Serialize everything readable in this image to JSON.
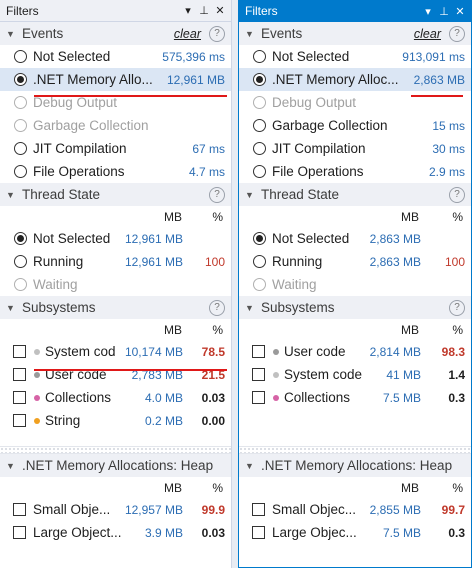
{
  "left": {
    "title": "Filters",
    "events": {
      "header": "Events",
      "clear": "clear",
      "help": "?",
      "items": [
        {
          "label": "Not Selected",
          "value": "575,396 ms",
          "state": "normal",
          "checked": false
        },
        {
          "label": ".NET Memory Allo...",
          "value": "12,961 MB",
          "state": "normal",
          "checked": true
        },
        {
          "label": "Debug Output",
          "value": "",
          "state": "disabled",
          "checked": false
        },
        {
          "label": "Garbage Collection",
          "value": "",
          "state": "disabled",
          "checked": false
        },
        {
          "label": "JIT Compilation",
          "value": "67 ms",
          "state": "normal",
          "checked": false
        },
        {
          "label": "File Operations",
          "value": "4.7 ms",
          "state": "normal",
          "checked": false
        }
      ]
    },
    "thread": {
      "header": "Thread State",
      "help": "?",
      "col_mb": "MB",
      "col_pct": "%",
      "items": [
        {
          "label": "Not Selected",
          "mb": "12,961 MB",
          "pct": "",
          "checked": true,
          "disabled": false
        },
        {
          "label": "Running",
          "mb": "12,961 MB",
          "pct": "100",
          "checked": false,
          "disabled": false
        },
        {
          "label": "Waiting",
          "mb": "",
          "pct": "",
          "checked": false,
          "disabled": true
        }
      ]
    },
    "subsystems": {
      "header": "Subsystems",
      "help": "?",
      "col_mb": "MB",
      "col_pct": "%",
      "items": [
        {
          "label": "System cod",
          "mb": "10,174 MB",
          "pct": "78.5",
          "dot": "#c0c0c0",
          "pct_color": "red"
        },
        {
          "label": "User code",
          "mb": "2,783 MB",
          "pct": "21.5",
          "dot": "#9a9a9a",
          "pct_color": "red"
        },
        {
          "label": "Collections",
          "mb": "4.0 MB",
          "pct": "0.03",
          "dot": "#d663a6",
          "pct_color": "black"
        },
        {
          "label": "String",
          "mb": "0.2 MB",
          "pct": "0.00",
          "dot": "#f0a020",
          "pct_color": "black"
        }
      ]
    },
    "heap": {
      "header": ".NET Memory Allocations: Heap",
      "col_mb": "MB",
      "col_pct": "%",
      "items": [
        {
          "label": "Small Obje...",
          "mb": "12,957 MB",
          "pct": "99.9",
          "pct_color": "red"
        },
        {
          "label": "Large Object...",
          "mb": "3.9 MB",
          "pct": "0.03",
          "pct_color": "black"
        }
      ]
    }
  },
  "right": {
    "title": "Filters",
    "events": {
      "header": "Events",
      "clear": "clear",
      "help": "?",
      "items": [
        {
          "label": "Not Selected",
          "value": "913,091 ms",
          "state": "normal",
          "checked": false
        },
        {
          "label": ".NET Memory Alloc...",
          "value": "2,863 MB",
          "state": "normal",
          "checked": true
        },
        {
          "label": "Debug Output",
          "value": "",
          "state": "disabled",
          "checked": false
        },
        {
          "label": "Garbage Collection",
          "value": "15 ms",
          "state": "normal",
          "checked": false
        },
        {
          "label": "JIT Compilation",
          "value": "30 ms",
          "state": "normal",
          "checked": false
        },
        {
          "label": "File Operations",
          "value": "2.9 ms",
          "state": "normal",
          "checked": false
        }
      ]
    },
    "thread": {
      "header": "Thread State",
      "help": "?",
      "col_mb": "MB",
      "col_pct": "%",
      "items": [
        {
          "label": "Not Selected",
          "mb": "2,863 MB",
          "pct": "",
          "checked": true,
          "disabled": false
        },
        {
          "label": "Running",
          "mb": "2,863 MB",
          "pct": "100",
          "checked": false,
          "disabled": false
        },
        {
          "label": "Waiting",
          "mb": "",
          "pct": "",
          "checked": false,
          "disabled": true
        }
      ]
    },
    "subsystems": {
      "header": "Subsystems",
      "help": "?",
      "col_mb": "MB",
      "col_pct": "%",
      "items": [
        {
          "label": "User code",
          "mb": "2,814 MB",
          "pct": "98.3",
          "dot": "#9a9a9a",
          "pct_color": "red"
        },
        {
          "label": "System code",
          "mb": "41 MB",
          "pct": "1.4",
          "dot": "#c0c0c0",
          "pct_color": "black"
        },
        {
          "label": "Collections",
          "mb": "7.5 MB",
          "pct": "0.3",
          "dot": "#d663a6",
          "pct_color": "black"
        }
      ]
    },
    "heap": {
      "header": ".NET Memory Allocations: Heap",
      "col_mb": "MB",
      "col_pct": "%",
      "items": [
        {
          "label": "Small Objec...",
          "mb": "2,855 MB",
          "pct": "99.7",
          "pct_color": "red"
        },
        {
          "label": "Large Objec...",
          "mb": "7.5 MB",
          "pct": "0.3",
          "pct_color": "black"
        }
      ]
    }
  },
  "colors": {
    "accent": "#007acc",
    "value_blue": "#2c6db3",
    "red": "#c0392b",
    "underline_red": "#e01818",
    "selected_row": "#dbe6f4"
  }
}
